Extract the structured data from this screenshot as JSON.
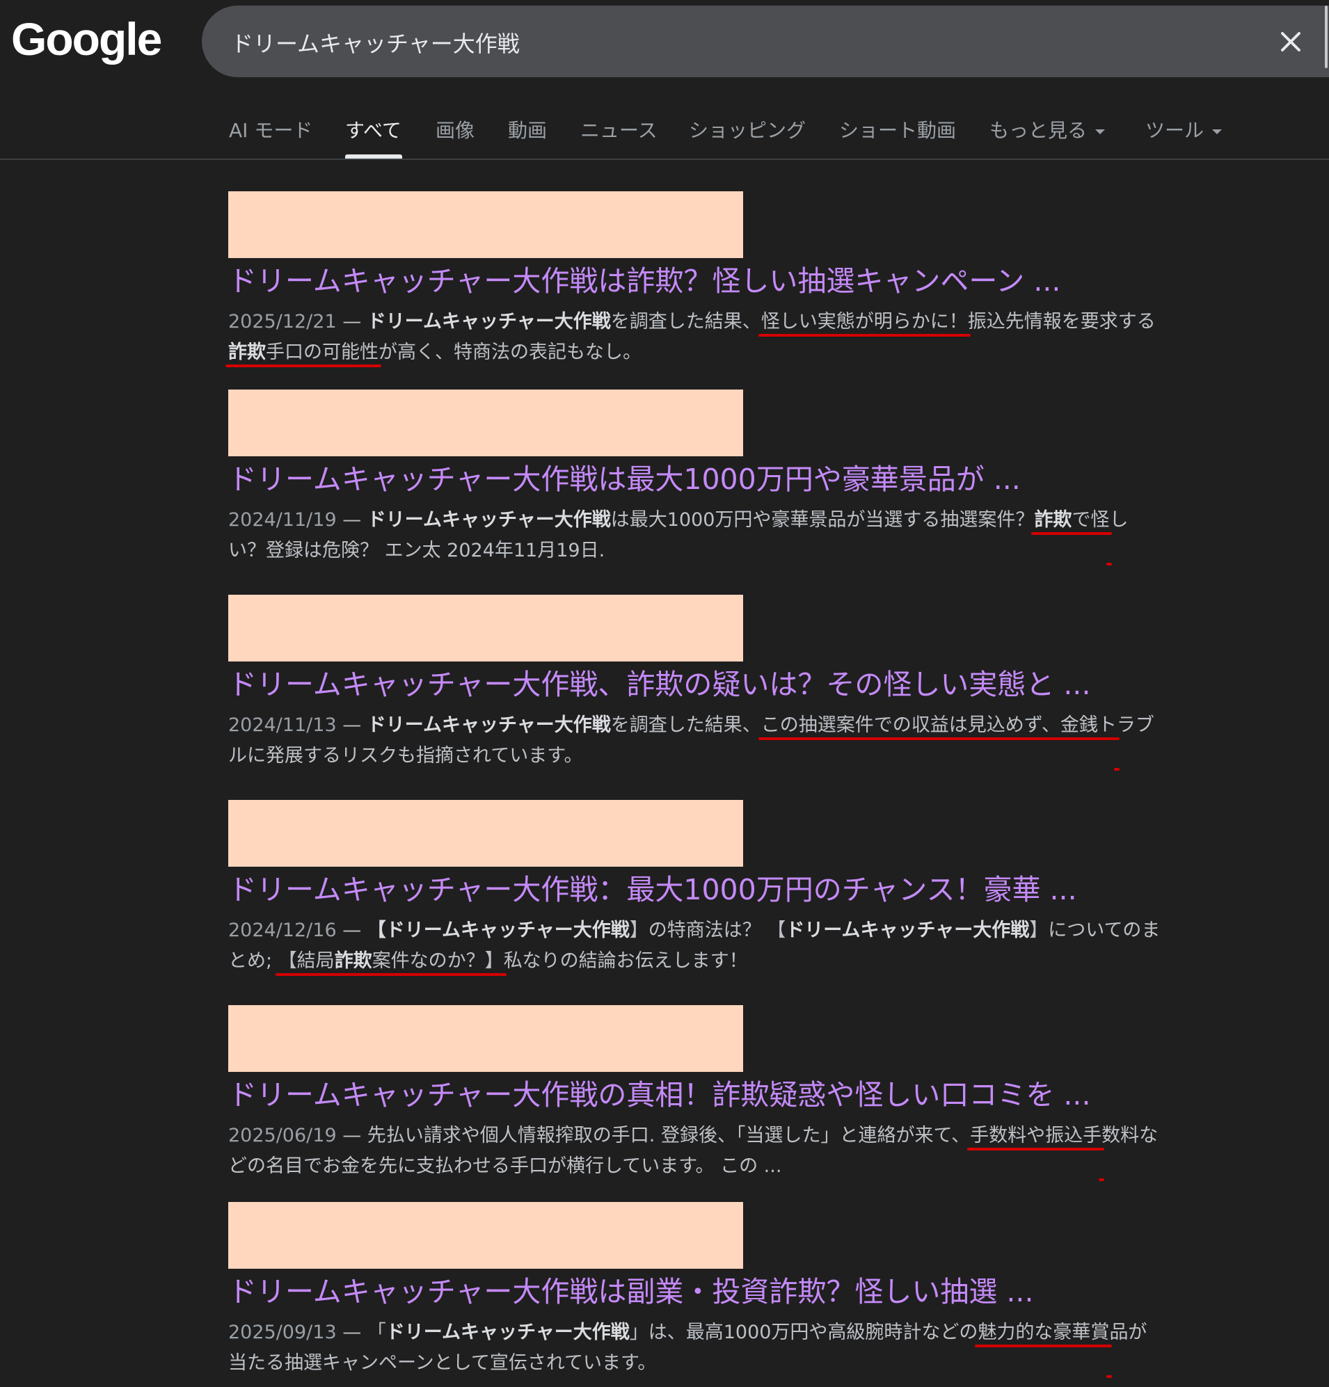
{
  "logo": "Google",
  "search": {
    "query": "ドリームキャッチャー大作戦"
  },
  "tabs": [
    {
      "label": "AI モード"
    },
    {
      "label": "すべて"
    },
    {
      "label": "画像"
    },
    {
      "label": "動画"
    },
    {
      "label": "ニュース"
    },
    {
      "label": "ショッピング"
    },
    {
      "label": "ショート動画"
    },
    {
      "label": "もっと見る"
    },
    {
      "label": "ツール"
    }
  ],
  "results": [
    {
      "title": "ドリームキャッチャー大作戦は詐欺？怪しい抽選キャンペーン ...",
      "date": "2025/12/21",
      "s": [
        "ドリームキャッチャー大作戦",
        "を調査した結果、",
        "怪しい実態が明らかに！",
        "振込先情報を要求する",
        "詐欺",
        "手口の可能性",
        "が高く、特商法の表記もなし。"
      ]
    },
    {
      "title": "ドリームキャッチャー大作戦は最大1000万円や豪華景品が ...",
      "date": "2024/11/19",
      "s": [
        "ドリームキャッチャー大作戦",
        "は最大1000万円や豪華景品が当選する抽選案件？",
        "詐欺",
        "で怪",
        "しい？登録は危険？",
        " エン太 2024年11月19日."
      ]
    },
    {
      "title": "ドリームキャッチャー大作戦、詐欺の疑いは？その怪しい実態と ...",
      "date": "2024/11/13",
      "s": [
        "ドリームキャッチャー大作戦",
        "を調査した結果、",
        "この抽選案件での収益は見込めず、金銭ト",
        "ラブルに発展するリスクも指摘",
        "されています。"
      ]
    },
    {
      "title": "ドリームキャッチャー大作戦：最大1000万円のチャンス！豪華 ...",
      "date": "2024/12/16",
      "s": [
        "【",
        "ドリームキャッチャー大作戦",
        "】の特商法は？ 【",
        "ドリームキャッチャー大作戦",
        "】につい",
        "てのまとめ; ",
        "【結局",
        "詐欺",
        "案件なのか？】",
        "私なりの結論お伝えします！"
      ]
    },
    {
      "title": "ドリームキャッチャー大作戦の真相！詐欺疑惑や怪しい口コミを ...",
      "date": "2025/06/19",
      "s": [
        "先払い請求や個人情報搾取の手口. 登録後、「当選した」と連絡が来て、",
        "手数料や振込手",
        "数料などの名目でお金を先に支払わせる手口が横行しています。",
        " この ..."
      ]
    },
    {
      "title": "ドリームキャッチャー大作戦は副業・投資詐欺？怪しい抽選 ...",
      "date": "2025/09/13",
      "s": [
        "「",
        "ドリームキャッチャー大作戦",
        "」は、最高1000万円や高級腕時計などの",
        "魅力的な豪華賞",
        "品が当たる抽選キャンペーンとして宣伝されています。"
      ]
    }
  ]
}
